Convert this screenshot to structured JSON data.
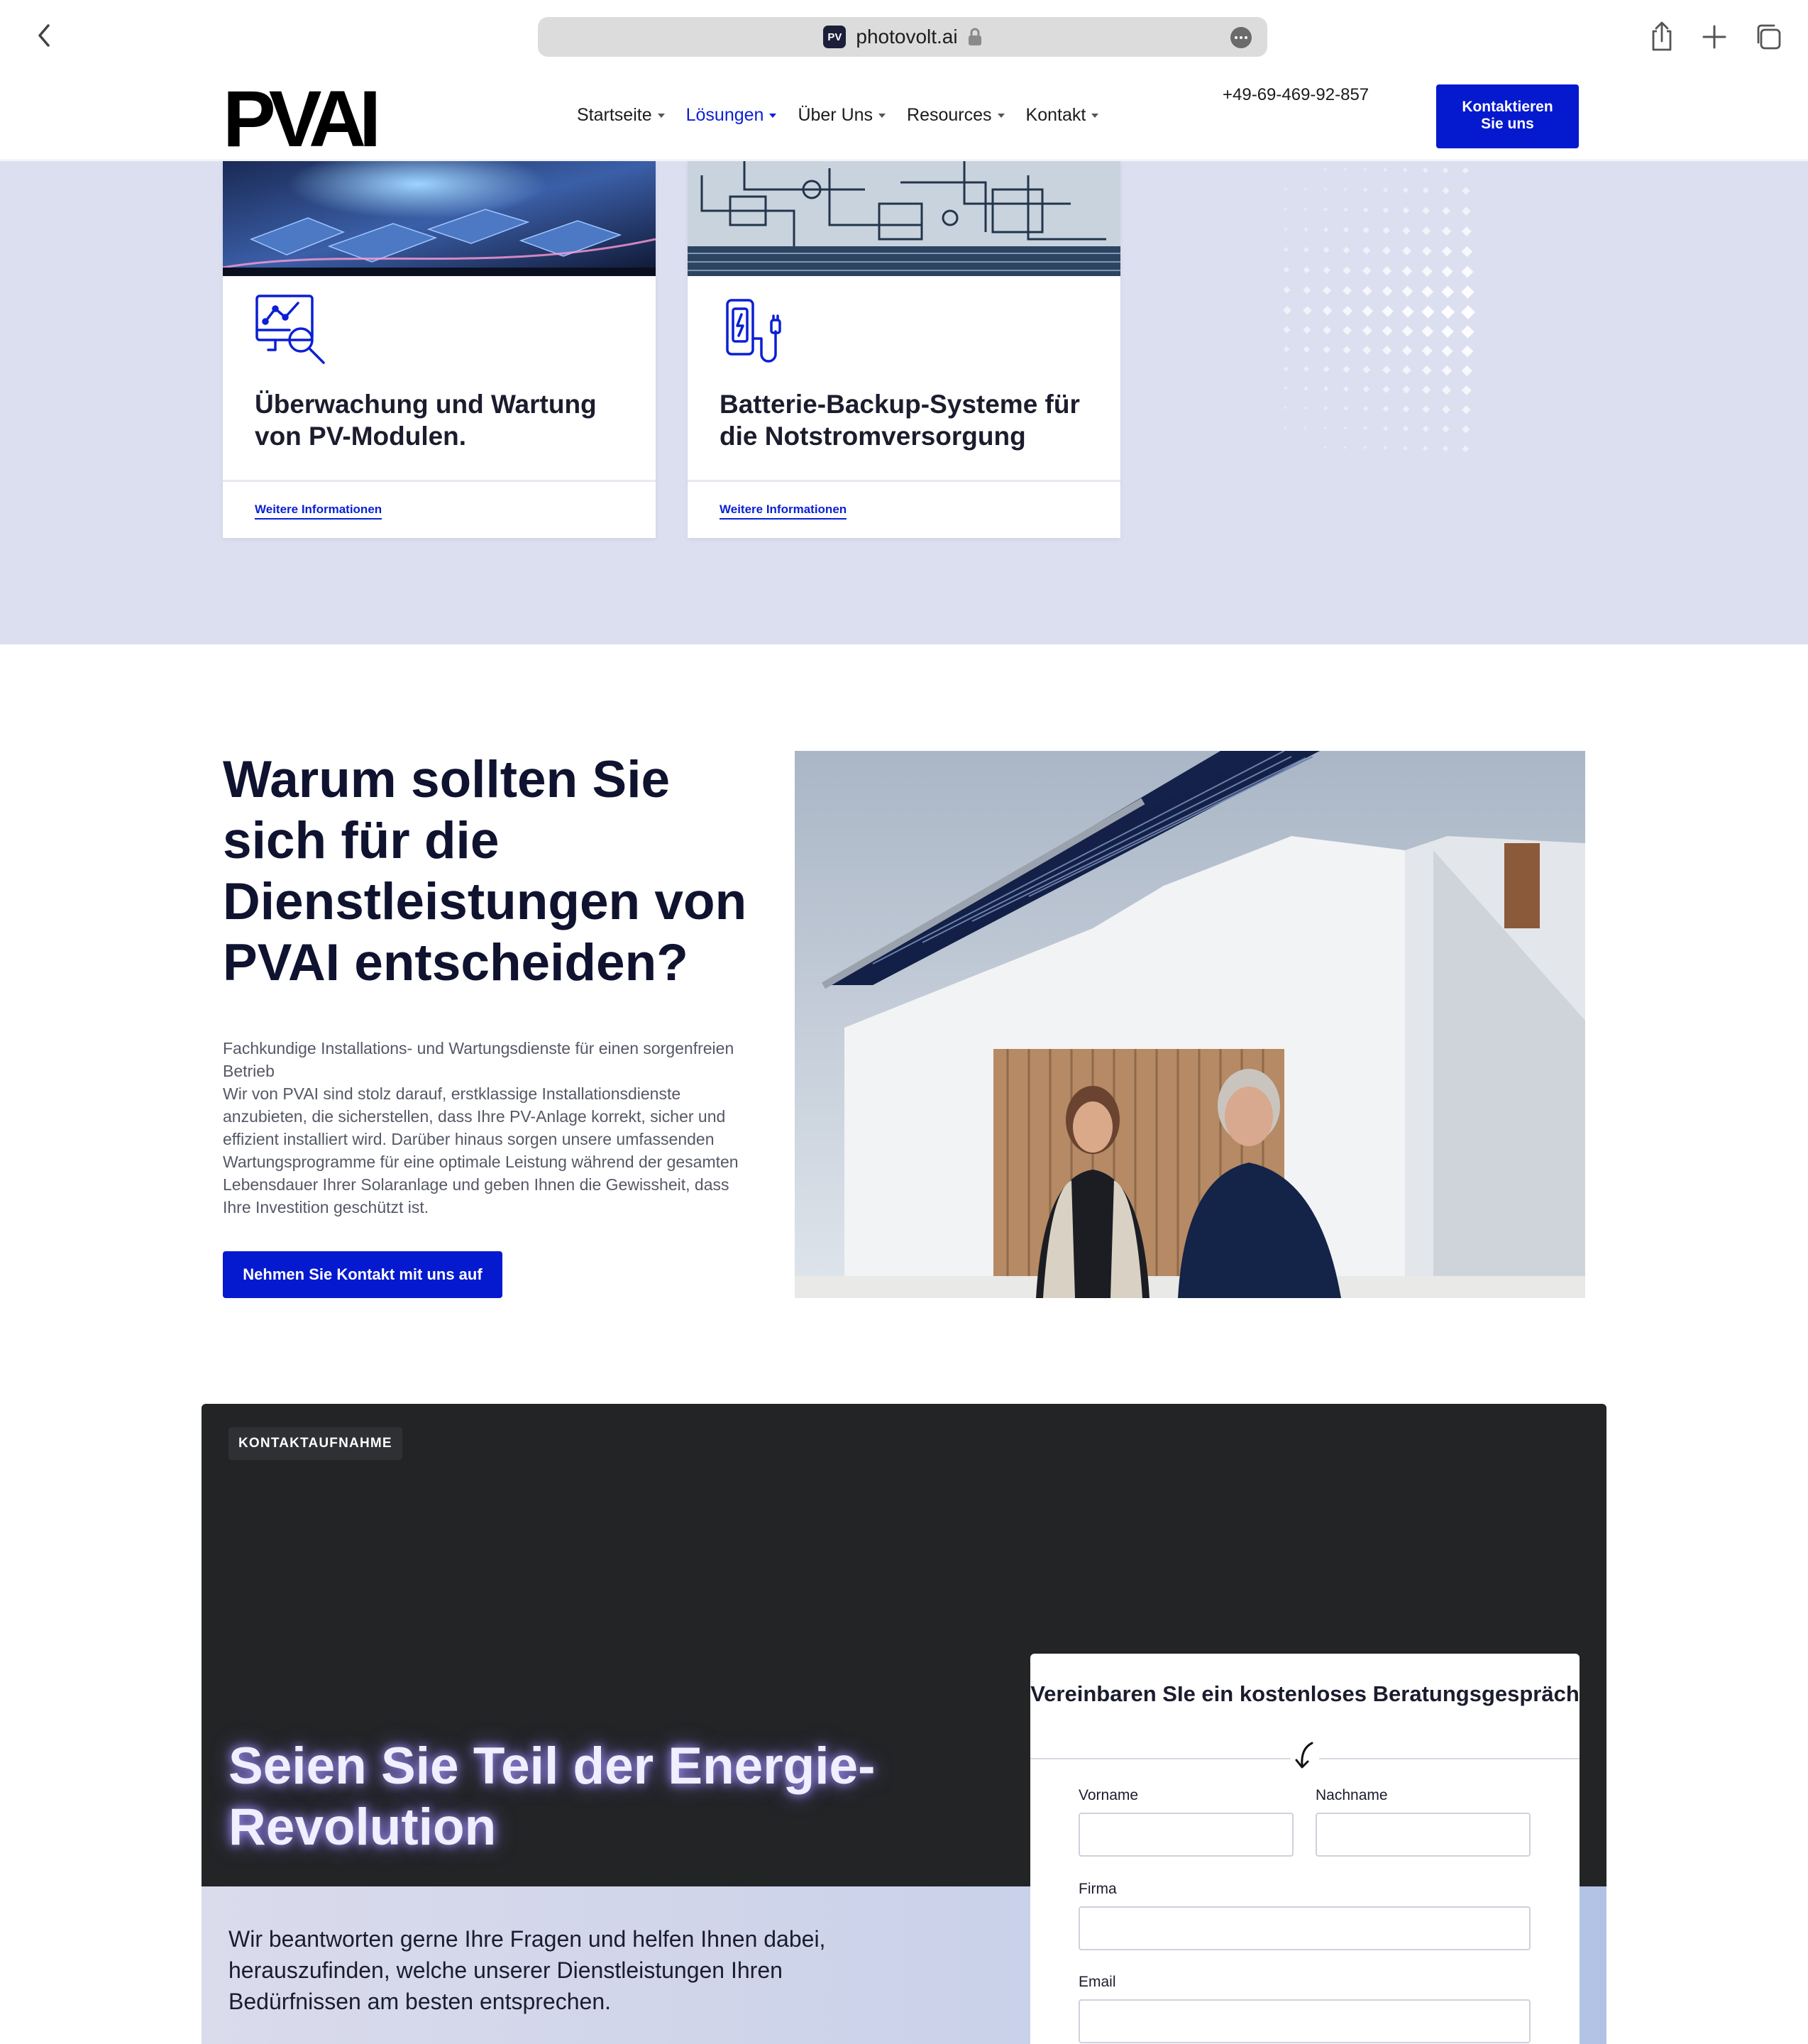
{
  "browser": {
    "url": "photovolt.ai",
    "favicon_text": "PV",
    "icons": [
      "back-icon",
      "lock-icon",
      "more-icon",
      "share-icon",
      "plus-icon",
      "tabs-icon"
    ]
  },
  "header": {
    "logo_text": "PVAI",
    "nav": [
      {
        "label": "Startseite",
        "active": false
      },
      {
        "label": "Lösungen",
        "active": true
      },
      {
        "label": "Über Uns",
        "active": false
      },
      {
        "label": "Resources",
        "active": false
      },
      {
        "label": "Kontakt",
        "active": false
      }
    ],
    "phone": "+49-69-469-92-857",
    "cta_line1": "Kontaktieren",
    "cta_line2": "Sie uns"
  },
  "services": {
    "cards": [
      {
        "icon": "monitoring-search-icon",
        "title": "Überwachung und Wartung von PV-Modulen.",
        "link": "Weitere Informationen"
      },
      {
        "icon": "battery-charger-icon",
        "title": "Batterie-Backup-Systeme für die Notstromversorgung",
        "link": "Weitere Informationen"
      }
    ]
  },
  "why": {
    "title": "Warum sollten Sie sich für die Dienstleistungen von PVAI entscheiden?",
    "subheading": "Fachkundige Installations- und Wartungsdienste für einen sorgenfreien Betrieb",
    "body": "Wir von PVAI sind stolz darauf, erstklassige Installationsdienste anzubieten, die sicherstellen, dass Ihre PV-Anlage korrekt, sicher und effizient installiert wird. Darüber hinaus sorgen unsere umfassenden Wartungsprogramme für eine optimale Leistung während der gesamten Lebensdauer Ihrer Solaranlage und geben Ihnen die Gewissheit, dass Ihre Investition geschützt ist.",
    "cta": "Nehmen Sie Kontakt mit uns auf"
  },
  "contact": {
    "badge": "KONTAKTAUFNAHME",
    "headline": "Seien Sie Teil der Energie-Revolution",
    "body": "Wir beantworten gerne Ihre Fragen und helfen Ihnen dabei, herauszufinden, welche unserer Dienstleistungen Ihren Bedürfnissen am besten entsprechen.",
    "form": {
      "title": "Vereinbaren SIe ein kostenloses Beratungsgespräch",
      "first_name_label": "Vorname",
      "first_name_value": "",
      "last_name_label": "Nachname",
      "last_name_value": "",
      "company_label": "Firma",
      "company_value": "",
      "email_label": "Email",
      "email_value": ""
    }
  },
  "colors": {
    "brand_blue": "#0519cf",
    "band_bg": "#dcdff0",
    "dark_bg": "#232426",
    "heading": "#0f1330"
  }
}
